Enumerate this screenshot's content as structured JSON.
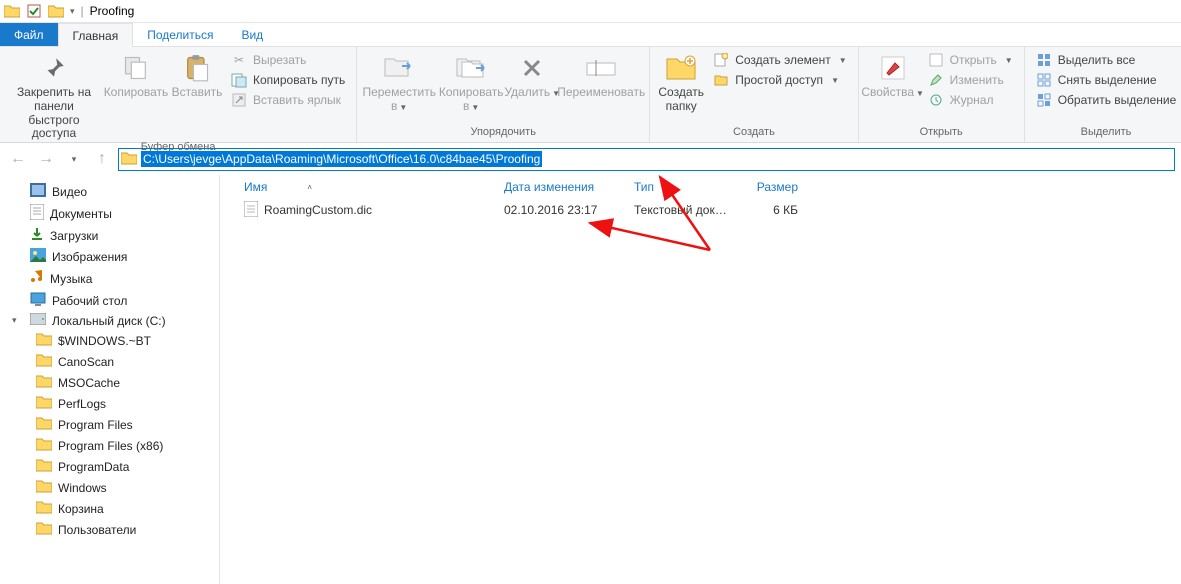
{
  "window": {
    "title": "Proofing"
  },
  "menu": {
    "file": "Файл",
    "home": "Главная",
    "share": "Поделиться",
    "view": "Вид"
  },
  "ribbon": {
    "pin": "Закрепить на панели\nбыстрого доступа",
    "copy": "Копировать",
    "paste": "Вставить",
    "cut": "Вырезать",
    "copypath": "Копировать путь",
    "pasteshortcut": "Вставить ярлык",
    "clipboard": "Буфер обмена",
    "moveto": "Переместить\nв",
    "copyto": "Копировать\nв",
    "delete": "Удалить",
    "rename": "Переименовать",
    "organize": "Упорядочить",
    "newfolder": "Создать\nпапку",
    "newitem": "Создать элемент",
    "easyaccess": "Простой доступ",
    "new": "Создать",
    "properties": "Свойства",
    "open_it": "Открыть",
    "edit": "Изменить",
    "history": "Журнал",
    "open": "Открыть",
    "selectall": "Выделить все",
    "selectnone": "Снять выделение",
    "invert": "Обратить выделение",
    "select": "Выделить"
  },
  "address": "C:\\Users\\jevge\\AppData\\Roaming\\Microsoft\\Office\\16.0\\c84bae45\\Proofing",
  "tree": {
    "video": "Видео",
    "documents": "Документы",
    "downloads": "Загрузки",
    "pictures": "Изображения",
    "music": "Музыка",
    "desktop": "Рабочий стол",
    "localdisk": "Локальный диск (C:)",
    "items": [
      "$WINDOWS.~BT",
      "CanoScan",
      "MSOCache",
      "PerfLogs",
      "Program Files",
      "Program Files (x86)",
      "ProgramData",
      "Windows",
      "Корзина",
      "Пользователи"
    ]
  },
  "columns": {
    "name": "Имя",
    "date": "Дата изменения",
    "type": "Тип",
    "size": "Размер"
  },
  "files": [
    {
      "name": "RoamingCustom.dic",
      "date": "02.10.2016 23:17",
      "type": "Текстовый докум...",
      "size": "6 КБ"
    }
  ]
}
